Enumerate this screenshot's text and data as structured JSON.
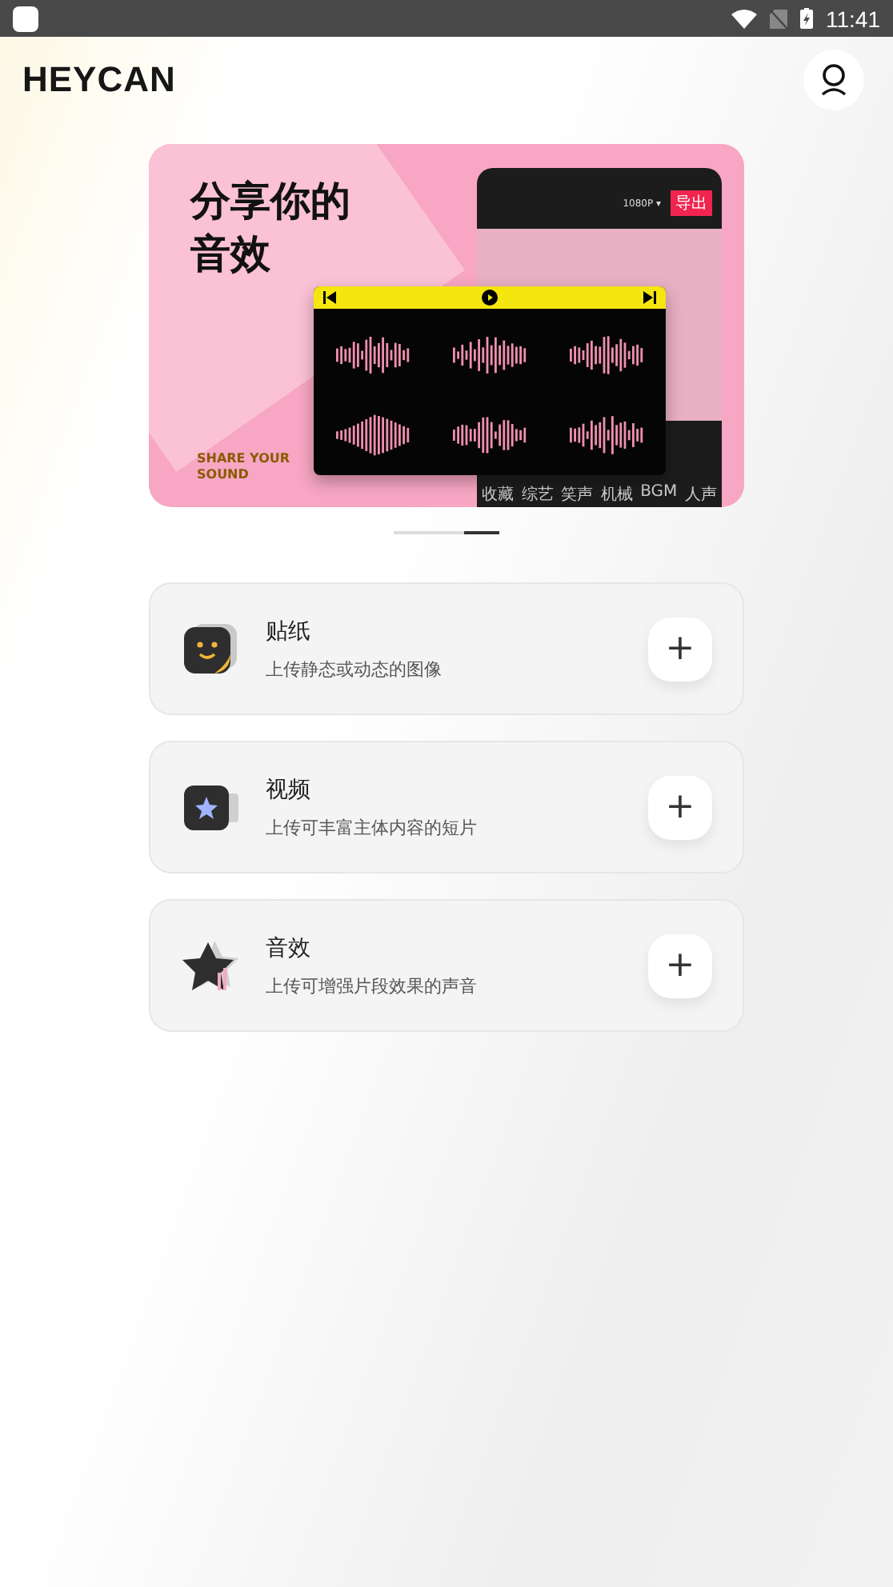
{
  "status_bar": {
    "time": "11:41"
  },
  "header": {
    "logo": "HEYCAN"
  },
  "banner": {
    "headline_lines": [
      "分享你的",
      "音效"
    ],
    "tagline_lines": [
      "SHARE YOUR",
      "SOUND"
    ],
    "resolution": "1080P ▾",
    "export_button": "导出",
    "categories": [
      "收藏",
      "综艺",
      "笑声",
      "机械",
      "BGM",
      "人声"
    ]
  },
  "carousel_dots": [
    {
      "selected": false
    },
    {
      "selected": true
    }
  ],
  "upload_cards": [
    {
      "kind": "sticker",
      "title": "贴纸",
      "subtitle": "上传静态或动态的图像",
      "button": "+"
    },
    {
      "kind": "video",
      "title": "视频",
      "subtitle": "上传可丰富主体内容的短片",
      "button": "+"
    },
    {
      "kind": "sound",
      "title": "音效",
      "subtitle": "上传可增强片段效果的声音",
      "button": "+"
    }
  ]
}
